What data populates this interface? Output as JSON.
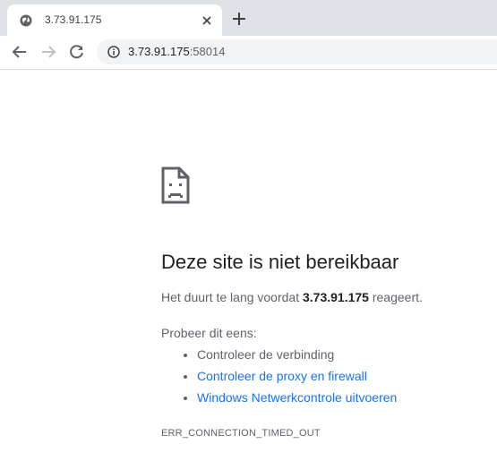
{
  "tab": {
    "title": "3.73.91.175",
    "favicon": "globe-icon"
  },
  "toolbar": {
    "url_host": "3.73.91.175",
    "url_port": ":58014",
    "icons": [
      "back-icon",
      "forward-icon",
      "reload-icon",
      "info-icon"
    ]
  },
  "error": {
    "headline": "Deze site is niet bereikbaar",
    "summary_prefix": "Het duurt te lang voordat ",
    "summary_host": "3.73.91.175",
    "summary_suffix": " reageert.",
    "suggestions_heading": "Probeer dit eens:",
    "suggestions": [
      {
        "label": "Controleer de verbinding",
        "link": false
      },
      {
        "label": "Controleer de proxy en firewall",
        "link": true
      },
      {
        "label": "Windows Netwerkcontrole uitvoeren",
        "link": true
      }
    ],
    "code": "ERR_CONNECTION_TIMED_OUT"
  },
  "colors": {
    "link": "#1a73e8",
    "tabstrip": "#dee1e6",
    "omnibox": "#f1f3f4"
  }
}
